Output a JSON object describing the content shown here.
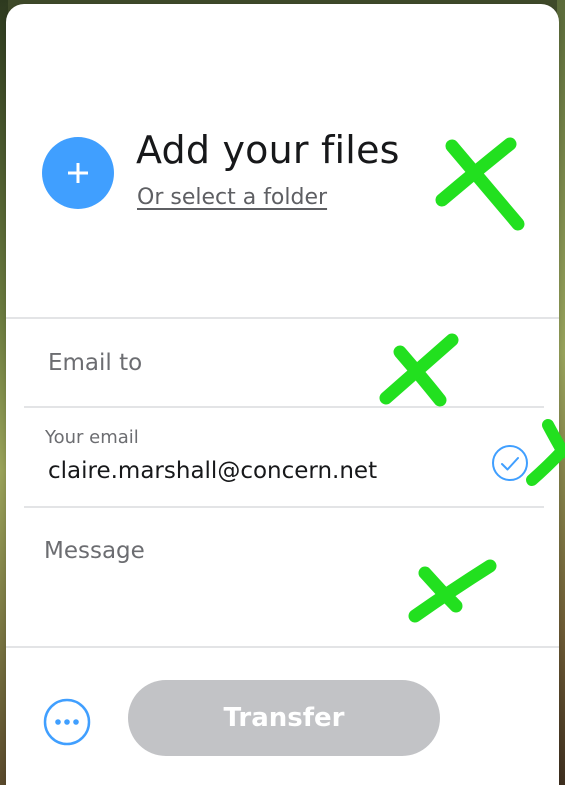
{
  "upload": {
    "title": "Add your files",
    "select_folder": "Or select a folder"
  },
  "form": {
    "email_to_placeholder": "Email to",
    "your_email_label": "Your email",
    "your_email_value": "claire.marshall@concern.net",
    "message_placeholder": "Message"
  },
  "footer": {
    "transfer_label": "Transfer"
  },
  "icons": {
    "add": "plus-icon",
    "verified": "check-circle-icon",
    "more": "more-options-icon"
  },
  "colors": {
    "accent_blue": "#409fff",
    "transfer_disabled": "#c2c3c6",
    "annotation_green": "#22e01f"
  }
}
